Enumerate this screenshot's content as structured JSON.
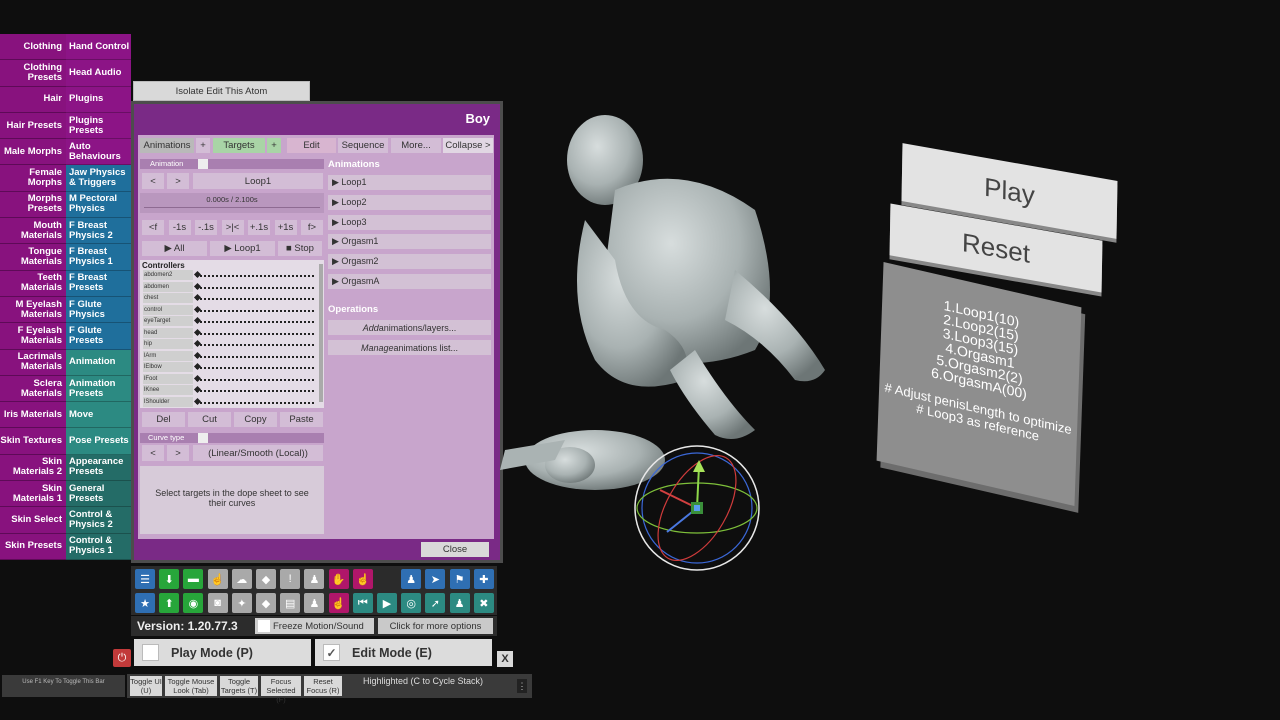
{
  "categories": [
    {
      "left": "Clothing",
      "right": "Hand Control",
      "color": "purple"
    },
    {
      "left": "Clothing Presets",
      "right": "Head Audio",
      "color": "purple"
    },
    {
      "left": "Hair",
      "right": "Plugins",
      "color": "purple"
    },
    {
      "left": "Hair Presets",
      "right": "Plugins Presets",
      "color": "purple"
    },
    {
      "left": "Male Morphs",
      "right": "Auto Behaviours",
      "color": "purple"
    },
    {
      "left": "Female Morphs",
      "right": "Jaw Physics & Triggers",
      "color": "blue"
    },
    {
      "left": "Morphs Presets",
      "right": "M Pectoral Physics",
      "color": "blue"
    },
    {
      "left": "Mouth Materials",
      "right": "F Breast Physics 2",
      "color": "blue"
    },
    {
      "left": "Tongue Materials",
      "right": "F Breast Physics 1",
      "color": "blue"
    },
    {
      "left": "Teeth Materials",
      "right": "F Breast Presets",
      "color": "blue"
    },
    {
      "left": "M Eyelash Materials",
      "right": "F Glute Physics",
      "color": "blue"
    },
    {
      "left": "F Eyelash Materials",
      "right": "F Glute Presets",
      "color": "blue"
    },
    {
      "left": "Lacrimals Materials",
      "right": "Animation",
      "color": "teal"
    },
    {
      "left": "Sclera Materials",
      "right": "Animation Presets",
      "color": "teal"
    },
    {
      "left": "Iris Materials",
      "right": "Move",
      "color": "teal"
    },
    {
      "left": "Skin Textures",
      "right": "Pose Presets",
      "color": "teal"
    },
    {
      "left": "Skin Materials 2",
      "right": "Appearance Presets",
      "color": "dteal"
    },
    {
      "left": "Skin Materials 1",
      "right": "General Presets",
      "color": "dteal"
    },
    {
      "left": "Skin Select",
      "right": "Control & Physics 2",
      "color": "dteal"
    },
    {
      "left": "Skin Presets",
      "right": "Control & Physics 1",
      "color": "dteal"
    }
  ],
  "isolate_label": "Isolate Edit This Atom",
  "panel": {
    "title": "Boy",
    "tabs": {
      "animations": "Animations",
      "plus1": "+",
      "targets": "Targets",
      "plus2": "+",
      "edit": "Edit",
      "sequence": "Sequence",
      "more": "More...",
      "collapse": "Collapse >"
    },
    "animation_label": "Animation",
    "prev": "<",
    "next": ">",
    "current_anim": "Loop1",
    "time": "0.000s / 2.100s",
    "scrub": [
      "<f",
      "-1s",
      "-.1s",
      ">|<",
      "+.1s",
      "+1s",
      "f>"
    ],
    "play_all": "▶ All",
    "play_loop": "▶ Loop1",
    "stop": "■ Stop",
    "controllers_header": "Controllers",
    "controllers": [
      "abdomen2",
      "abdomen",
      "chest",
      "control",
      "eyeTarget",
      "head",
      "hip",
      "lArm",
      "lElbow",
      "lFoot",
      "lKnee",
      "lShoulder"
    ],
    "edit_ops": [
      "Del",
      "Cut",
      "Copy",
      "Paste"
    ],
    "curve_type_label": "Curve type",
    "curve_value": "(Linear/Smooth (Local))",
    "hint": "Select targets in the dope sheet to see their curves",
    "animations_header": "Animations",
    "animation_list": [
      "▶ Loop1",
      "▶ Loop2",
      "▶ Loop3",
      "▶ Orgasm1",
      "▶ Orgasm2",
      "▶ OrgasmA"
    ],
    "operations_header": "Operations",
    "op_add_em": "Add",
    "op_add_rest": " animations/layers...",
    "op_manage_em": "Manage",
    "op_manage_rest": " animations list...",
    "close": "Close"
  },
  "toolbar": {
    "row1": [
      {
        "icon": "menu-icon",
        "glyph": "☰",
        "color": "blue"
      },
      {
        "icon": "save-icon",
        "glyph": "⬇",
        "color": "green"
      },
      {
        "icon": "open-folder-icon",
        "glyph": "▬",
        "color": "green"
      },
      {
        "icon": "hand-point-icon",
        "glyph": "☝",
        "color": "grey"
      },
      {
        "icon": "cloud-download-icon",
        "glyph": "☁",
        "color": "grey"
      },
      {
        "icon": "cube-icon",
        "glyph": "◆",
        "color": "grey"
      },
      {
        "icon": "alert-icon",
        "glyph": "!",
        "color": "grey"
      },
      {
        "icon": "person-add-icon",
        "glyph": "♟",
        "color": "grey"
      },
      {
        "icon": "hand-icon",
        "glyph": "✋",
        "color": "pink"
      },
      {
        "icon": "hand-pointer-icon",
        "glyph": "☝",
        "color": "pink"
      },
      {
        "icon": "person-icon",
        "glyph": "♟",
        "color": "blue"
      },
      {
        "icon": "send-icon",
        "glyph": "➤",
        "color": "blue"
      },
      {
        "icon": "flag-icon",
        "glyph": "⚑",
        "color": "blue"
      },
      {
        "icon": "plus-icon",
        "glyph": "✚",
        "color": "blue"
      }
    ],
    "row2": [
      {
        "icon": "star-icon",
        "glyph": "★",
        "color": "blue"
      },
      {
        "icon": "import-icon",
        "glyph": "⬆",
        "color": "green"
      },
      {
        "icon": "screenshot-icon",
        "glyph": "◉",
        "color": "green"
      },
      {
        "icon": "camera-icon",
        "glyph": "◙",
        "color": "grey"
      },
      {
        "icon": "node-icon",
        "glyph": "✦",
        "color": "grey"
      },
      {
        "icon": "cubes-icon",
        "glyph": "◆",
        "color": "grey"
      },
      {
        "icon": "document-icon",
        "glyph": "▤",
        "color": "grey"
      },
      {
        "icon": "person-remove-icon",
        "glyph": "♟",
        "color": "grey"
      },
      {
        "icon": "pointer-icon",
        "glyph": "☝",
        "color": "pink"
      },
      {
        "icon": "skip-back-icon",
        "glyph": "⏮",
        "color": "teal"
      },
      {
        "icon": "play-icon",
        "glyph": "▶",
        "color": "teal"
      },
      {
        "icon": "target-icon",
        "glyph": "◎",
        "color": "teal"
      },
      {
        "icon": "cursor-icon",
        "glyph": "➚",
        "color": "teal"
      },
      {
        "icon": "people-icon",
        "glyph": "♟",
        "color": "teal"
      },
      {
        "icon": "wrench-icon",
        "glyph": "✖",
        "color": "teal"
      }
    ]
  },
  "version": "Version: 1.20.77.3",
  "freeze": "Freeze Motion/Sound",
  "more_options": "Click for more options",
  "play_mode": "Play Mode (P)",
  "edit_mode": "Edit Mode (E)",
  "edit_check": "✓",
  "close_x": "X",
  "f1_hint": "Use F1 Key To Toggle This Bar",
  "bottom_buttons": [
    {
      "label": "Toggle UI (U)"
    },
    {
      "label": "Toggle Mouse Look (Tab)"
    },
    {
      "label": "Toggle Targets (T)"
    },
    {
      "label": "Focus Selected (F)"
    },
    {
      "label": "Reset Focus (R)"
    }
  ],
  "highlighted": "Highlighted (C to Cycle Stack)",
  "kebab": "⋮",
  "scene": {
    "play_button": "Play",
    "reset_button": "Reset",
    "info_lines": [
      "1.Loop1(10)",
      "2.Loop2(15)",
      "3.Loop3(15)",
      "4.Orgasm1",
      "5.Orgasm2(2)",
      "6.OrgasmA(00)"
    ],
    "info_notes": [
      "# Adjust penisLength to optimize",
      "# Loop3 as reference"
    ]
  }
}
